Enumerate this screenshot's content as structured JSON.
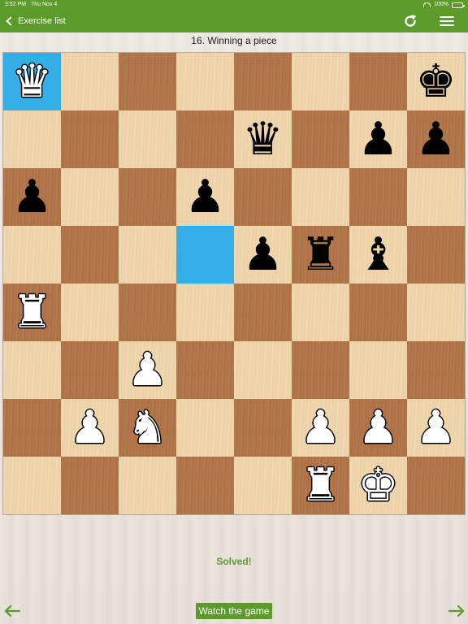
{
  "status_bar": {
    "time": "3:52 PM",
    "date": "Thu Nov 4",
    "battery": "100%"
  },
  "nav": {
    "back_label": "Exercise list",
    "refresh_icon": "refresh-icon",
    "menu_icon": "hamburger-menu-icon"
  },
  "exercise": {
    "title": "16. Winning a piece",
    "status": "Solved!"
  },
  "board": {
    "highlighted_squares": [
      "a8",
      "d5"
    ],
    "pieces": [
      {
        "square": "a8",
        "color": "white",
        "type": "queen"
      },
      {
        "square": "h8",
        "color": "black",
        "type": "king"
      },
      {
        "square": "e7",
        "color": "black",
        "type": "queen"
      },
      {
        "square": "g7",
        "color": "black",
        "type": "pawn"
      },
      {
        "square": "h7",
        "color": "black",
        "type": "pawn"
      },
      {
        "square": "a6",
        "color": "black",
        "type": "pawn"
      },
      {
        "square": "d6",
        "color": "black",
        "type": "pawn"
      },
      {
        "square": "e5",
        "color": "black",
        "type": "pawn"
      },
      {
        "square": "f5",
        "color": "black",
        "type": "rook"
      },
      {
        "square": "g5",
        "color": "black",
        "type": "bishop"
      },
      {
        "square": "a4",
        "color": "white",
        "type": "rook"
      },
      {
        "square": "c3",
        "color": "white",
        "type": "pawn"
      },
      {
        "square": "b2",
        "color": "white",
        "type": "pawn"
      },
      {
        "square": "c2",
        "color": "white",
        "type": "knight"
      },
      {
        "square": "f2",
        "color": "white",
        "type": "pawn"
      },
      {
        "square": "g2",
        "color": "white",
        "type": "pawn"
      },
      {
        "square": "h2",
        "color": "white",
        "type": "pawn"
      },
      {
        "square": "f1",
        "color": "white",
        "type": "rook"
      },
      {
        "square": "g1",
        "color": "white",
        "type": "king"
      }
    ]
  },
  "controls": {
    "watch_label": "Watch the game",
    "prev_icon": "arrow-left-icon",
    "next_icon": "arrow-right-icon"
  },
  "colors": {
    "accent_green": "#5d9a2c",
    "highlight_blue": "#33aee6",
    "light_square": "#f0d8b0",
    "dark_square": "#b67a4d"
  }
}
